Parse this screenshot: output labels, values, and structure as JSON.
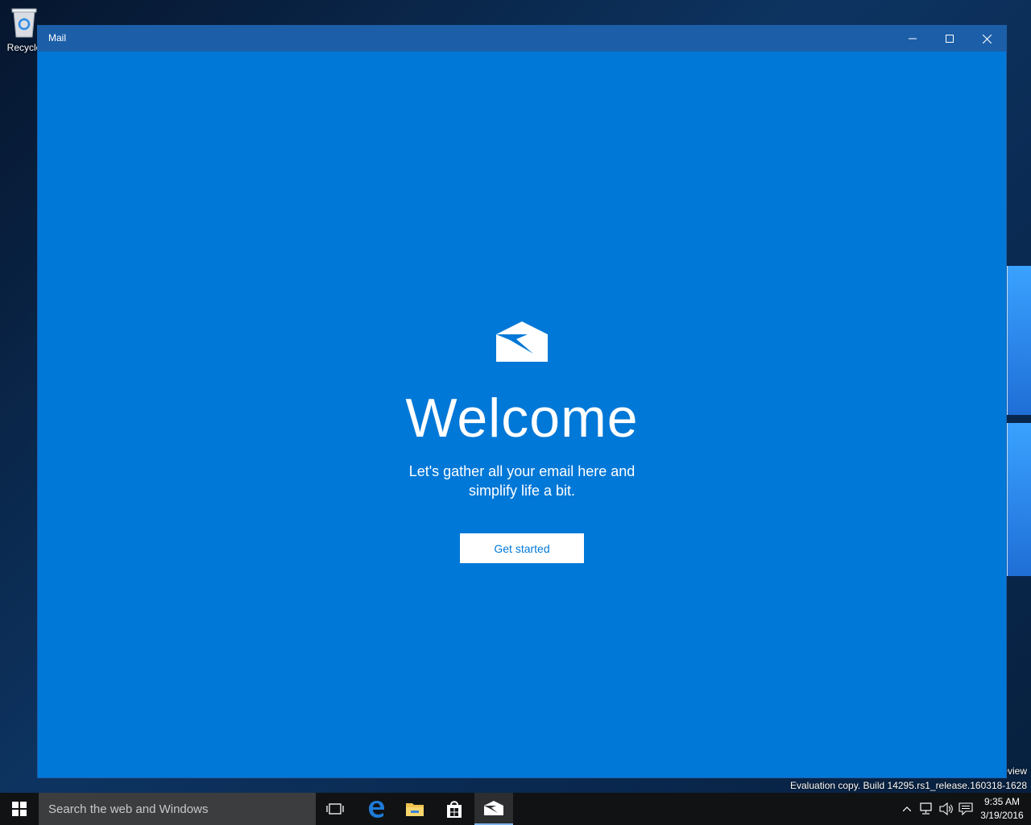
{
  "desktop": {
    "recycle_label": "Recycle",
    "watermark_line1": "eview",
    "watermark_line2": "Evaluation copy. Build 14295.rs1_release.160318-1628"
  },
  "window": {
    "title": "Mail",
    "controls": {
      "minimize": "minimize-icon",
      "maximize": "maximize-icon",
      "close": "close-icon"
    }
  },
  "welcome": {
    "heading": "Welcome",
    "subtitle_line1": "Let's gather all your email here and",
    "subtitle_line2": "simplify life a bit.",
    "cta_label": "Get started"
  },
  "taskbar": {
    "search_placeholder": "Search the web and Windows",
    "icons": [
      "windows-start-icon",
      "task-view-icon",
      "edge-icon",
      "file-explorer-icon",
      "store-icon",
      "mail-icon"
    ],
    "time": "9:35 AM",
    "date": "3/19/2016"
  },
  "colors": {
    "accent": "#0078d7",
    "titlebar": "#1c5fa8",
    "taskbar": "#101214",
    "search_box": "#3b3d3f"
  }
}
